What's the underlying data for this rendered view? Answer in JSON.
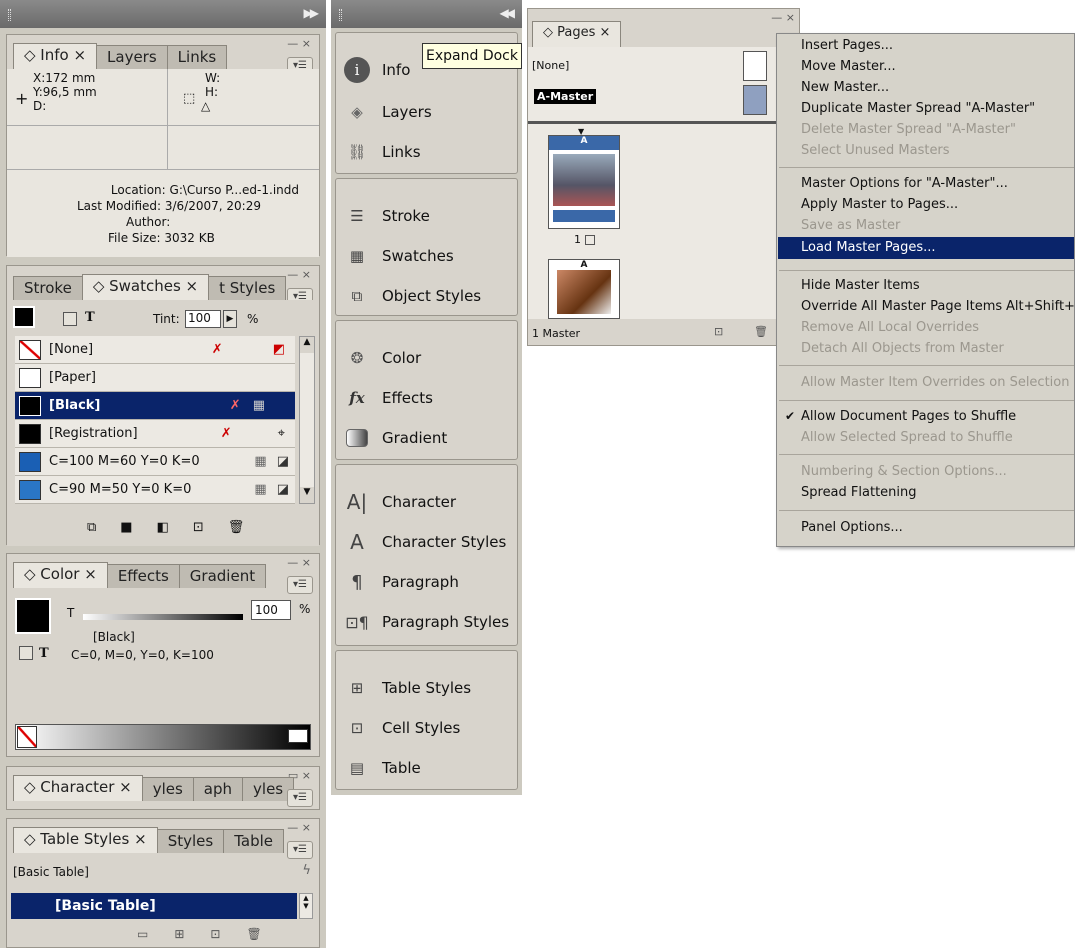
{
  "left_dock": {
    "info_panel": {
      "tabs": [
        "◇ Info ×",
        "Layers",
        "Links"
      ],
      "x": "X:172 mm",
      "y": "Y:96,5 mm",
      "d": "D:",
      "w": "W:",
      "h": "H:",
      "location": "Location: G:\\Curso P...ed-1.indd",
      "last_modified": "Last Modified: 3/6/2007, 20:29",
      "author": "Author:",
      "file_size": "File Size: 3032 KB"
    },
    "swatches_panel": {
      "tabs": [
        "Stroke",
        "◇ Swatches ×",
        "t Styles"
      ],
      "fill_stroke_t": "T",
      "tint_label": "Tint:",
      "tint_value": "100",
      "percent": "%",
      "swatches": [
        {
          "name": "[None]",
          "color": "#ffffff"
        },
        {
          "name": "[Paper]",
          "color": "#ffffff"
        },
        {
          "name": "[Black]",
          "color": "#000000"
        },
        {
          "name": "[Registration]",
          "color": "#000000"
        },
        {
          "name": "C=100 M=60 Y=0 K=0",
          "color": "#1a5fb4"
        },
        {
          "name": "C=90 M=50 Y=0 K=0",
          "color": "#2a76c6"
        }
      ]
    },
    "color_panel": {
      "tabs": [
        "◇ Color ×",
        "Effects",
        "Gradient"
      ],
      "t_label": "T",
      "value": "100",
      "percent": "%",
      "swatch_name": "[Black]",
      "cmyk": "C=0, M=0, Y=0, K=100"
    },
    "character_panel": {
      "tabs": [
        "◇ Character ×",
        "yles",
        "aph",
        "yles"
      ]
    },
    "table_styles_panel": {
      "tabs": [
        "◇ Table Styles ×",
        "Styles",
        "Table"
      ],
      "basic_table": "[Basic Table]",
      "selected": "[Basic Table]"
    }
  },
  "mid_dock": {
    "tooltip": "Expand Dock",
    "groups": [
      [
        {
          "label": "Info",
          "icon": "info-icon"
        },
        {
          "label": "Layers",
          "icon": "layers-icon"
        },
        {
          "label": "Links",
          "icon": "links-icon"
        }
      ],
      [
        {
          "label": "Stroke",
          "icon": "stroke-icon"
        },
        {
          "label": "Swatches",
          "icon": "swatches-icon"
        },
        {
          "label": "Object Styles",
          "icon": "object-styles-icon"
        }
      ],
      [
        {
          "label": "Color",
          "icon": "color-icon"
        },
        {
          "label": "Effects",
          "icon": "effects-icon"
        },
        {
          "label": "Gradient",
          "icon": "gradient-icon"
        }
      ],
      [
        {
          "label": "Character",
          "icon": "character-icon"
        },
        {
          "label": "Character Styles",
          "icon": "character-styles-icon"
        },
        {
          "label": "Paragraph",
          "icon": "paragraph-icon"
        },
        {
          "label": "Paragraph Styles",
          "icon": "paragraph-styles-icon"
        }
      ],
      [
        {
          "label": "Table Styles",
          "icon": "table-styles-icon"
        },
        {
          "label": "Cell Styles",
          "icon": "cell-styles-icon"
        },
        {
          "label": "Table",
          "icon": "table-icon"
        }
      ]
    ]
  },
  "pages_panel": {
    "tab": "◇ Pages ×",
    "none_master": "[None]",
    "a_master": "A-Master",
    "page_1_label": "1",
    "status": "1 Master",
    "thumb_letter": "A"
  },
  "menu": {
    "items": [
      {
        "label": "Insert Pages...",
        "disabled": false
      },
      {
        "label": "Move Master...",
        "disabled": false
      },
      {
        "label": "New Master...",
        "disabled": false
      },
      {
        "label": "Duplicate Master Spread \"A-Master\"",
        "disabled": false
      },
      {
        "label": "Delete Master Spread \"A-Master\"",
        "disabled": true
      },
      {
        "label": "Select Unused Masters",
        "disabled": true
      },
      {
        "label": "Master Options for \"A-Master\"...",
        "disabled": false
      },
      {
        "label": "Apply Master to Pages...",
        "disabled": false
      },
      {
        "label": "Save as Master",
        "disabled": true
      },
      {
        "label": "Load Master Pages...",
        "disabled": false,
        "highlighted": true
      },
      {
        "label": "Hide Master Items",
        "disabled": false
      },
      {
        "label": "Override All Master Page Items",
        "shortcut": "Alt+Shift+",
        "disabled": false
      },
      {
        "label": "Remove All Local Overrides",
        "disabled": true
      },
      {
        "label": "Detach All Objects from Master",
        "disabled": true
      },
      {
        "label": "Allow Master Item Overrides on Selection",
        "disabled": true
      },
      {
        "label": "Allow Document Pages to Shuffle",
        "disabled": false,
        "checked": true
      },
      {
        "label": "Allow Selected Spread to Shuffle",
        "disabled": true
      },
      {
        "label": "Numbering & Section Options...",
        "disabled": true
      },
      {
        "label": "Spread Flattening",
        "disabled": false
      },
      {
        "label": "Panel Options...",
        "disabled": false
      }
    ]
  }
}
